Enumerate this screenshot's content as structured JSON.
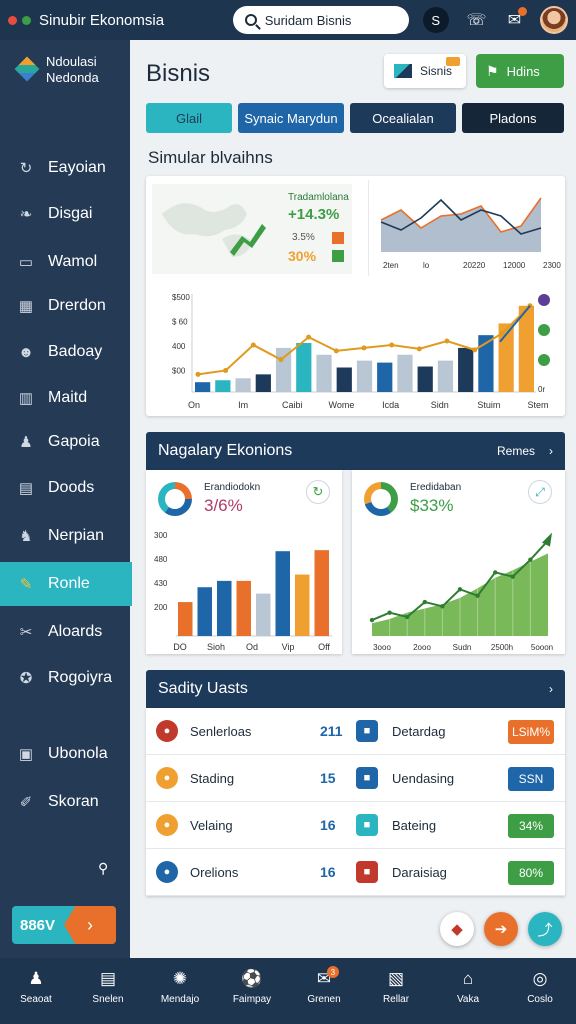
{
  "app": {
    "title": "Sinubir Ekonomsia",
    "search_placeholder": "Suridam Bisnis",
    "user_initial": "S"
  },
  "brand": {
    "line1": "Ndoulasi",
    "line2": "Nedonda"
  },
  "sidebar": {
    "items": [
      {
        "label": "Eayoian",
        "icon": "refresh-icon"
      },
      {
        "label": "Disgai",
        "icon": "leaf-icon"
      },
      {
        "label": "Wamol",
        "icon": "card-icon"
      },
      {
        "label": "Drerdon",
        "icon": "grid-icon"
      },
      {
        "label": "Badoay",
        "icon": "people-icon"
      },
      {
        "label": "Maitd",
        "icon": "chart-icon"
      },
      {
        "label": "Gapoia",
        "icon": "person-icon"
      },
      {
        "label": "Doods",
        "icon": "book-icon"
      },
      {
        "label": "Nerpian",
        "icon": "fox-icon"
      },
      {
        "label": "Ronle",
        "icon": "chat-icon"
      },
      {
        "label": "Aloards",
        "icon": "tools-icon"
      },
      {
        "label": "Rogoiyra",
        "icon": "location-icon"
      },
      {
        "label": "Ubonola",
        "icon": "calendar-icon"
      },
      {
        "label": "Skoran",
        "icon": "wrench-icon"
      }
    ],
    "active_index": 9,
    "cta_value": "886V"
  },
  "header": {
    "title": "Bisnis",
    "button1_label": "Sisnis",
    "button2_label": "Hdins",
    "tabs": [
      "Glail",
      "Synaic Marydun",
      "Ocealialan",
      "Pladons"
    ]
  },
  "simulation": {
    "title": "Simular blvaihns",
    "stat_label": "Tradamlolana",
    "stat_percent": "+14.3%",
    "stat_small": "3.5%",
    "stat_value": "30%"
  },
  "mini_chart": {
    "x_labels": [
      "2ten",
      "lo",
      "20220",
      "12000",
      "2300"
    ]
  },
  "chart_data": [
    {
      "type": "bar",
      "categories": [
        "On",
        "Im",
        "Caibi",
        "Wome",
        "Icda",
        "Sidn",
        "Stuim",
        "Stem"
      ],
      "y_ticks": [
        "$500",
        "$ 60",
        "400",
        "$00"
      ],
      "series": [
        {
          "values": [
            10,
            12,
            14,
            18,
            45,
            50,
            38,
            25,
            32,
            30,
            38,
            26,
            32,
            45,
            58,
            70,
            88
          ]
        }
      ],
      "line": [
        18,
        22,
        48,
        33,
        56,
        42,
        45,
        48,
        44,
        52,
        43,
        60,
        88
      ],
      "ylim": [
        0,
        100
      ]
    },
    {
      "type": "bar",
      "title": "Nagalary Ekonions",
      "header_action": "Remes",
      "label": "Erandiodokn",
      "headline": "3/6%",
      "categories": [
        "DO",
        "Sioh",
        "Od",
        "Vip",
        "Off"
      ],
      "y_ticks": [
        "300",
        "480",
        "430",
        "200"
      ],
      "values": [
        32,
        46,
        52,
        52,
        40,
        80,
        58,
        81
      ],
      "ylim": [
        0,
        100
      ]
    },
    {
      "type": "area",
      "label": "Eredidaban",
      "headline": "$33%",
      "x_labels": [
        "3ooo",
        "2ooo",
        "Sudn",
        "2500h",
        "5ooon"
      ],
      "values": [
        12,
        16,
        22,
        26,
        30,
        36,
        45,
        55,
        62,
        70,
        78
      ],
      "line": [
        15,
        22,
        18,
        32,
        28,
        44,
        38,
        60,
        56,
        72,
        90
      ],
      "ylim": [
        0,
        100
      ]
    }
  ],
  "stats_list": {
    "title": "Sadity Uasts",
    "rows": [
      {
        "left_label": "Senlerloas",
        "left_count": "211",
        "right_label": "Detardag",
        "right_value": "LSiM%",
        "pill_color": "#e8702a"
      },
      {
        "left_label": "Stading",
        "left_count": "15",
        "right_label": "Uendasing",
        "right_value": "SSN",
        "pill_color": "#1e66a8"
      },
      {
        "left_label": "Velaing",
        "left_count": "16",
        "right_label": "Bateing",
        "right_value": "34%",
        "pill_color": "#3d9e45"
      },
      {
        "left_label": "Orelions",
        "left_count": "16",
        "right_label": "Daraisiag",
        "right_value": "80%",
        "pill_color": "#3d9e45"
      }
    ]
  },
  "bottom_nav": [
    {
      "label": "Seaoat",
      "icon": "user-icon"
    },
    {
      "label": "Snelen",
      "icon": "document-icon"
    },
    {
      "label": "Mendajo",
      "icon": "gear-icon"
    },
    {
      "label": "Faimpay",
      "icon": "soccer-icon"
    },
    {
      "label": "Grenen",
      "icon": "mail-icon",
      "badge": "3"
    },
    {
      "label": "Rellar",
      "icon": "box-icon"
    },
    {
      "label": "Vaka",
      "icon": "home-icon"
    },
    {
      "label": "Coslo",
      "icon": "circle-icon"
    }
  ],
  "colors": {
    "navy": "#1e3550",
    "teal": "#2bb5c0",
    "orange": "#e8702a",
    "green": "#3d9e45",
    "blue": "#1e66a8"
  }
}
